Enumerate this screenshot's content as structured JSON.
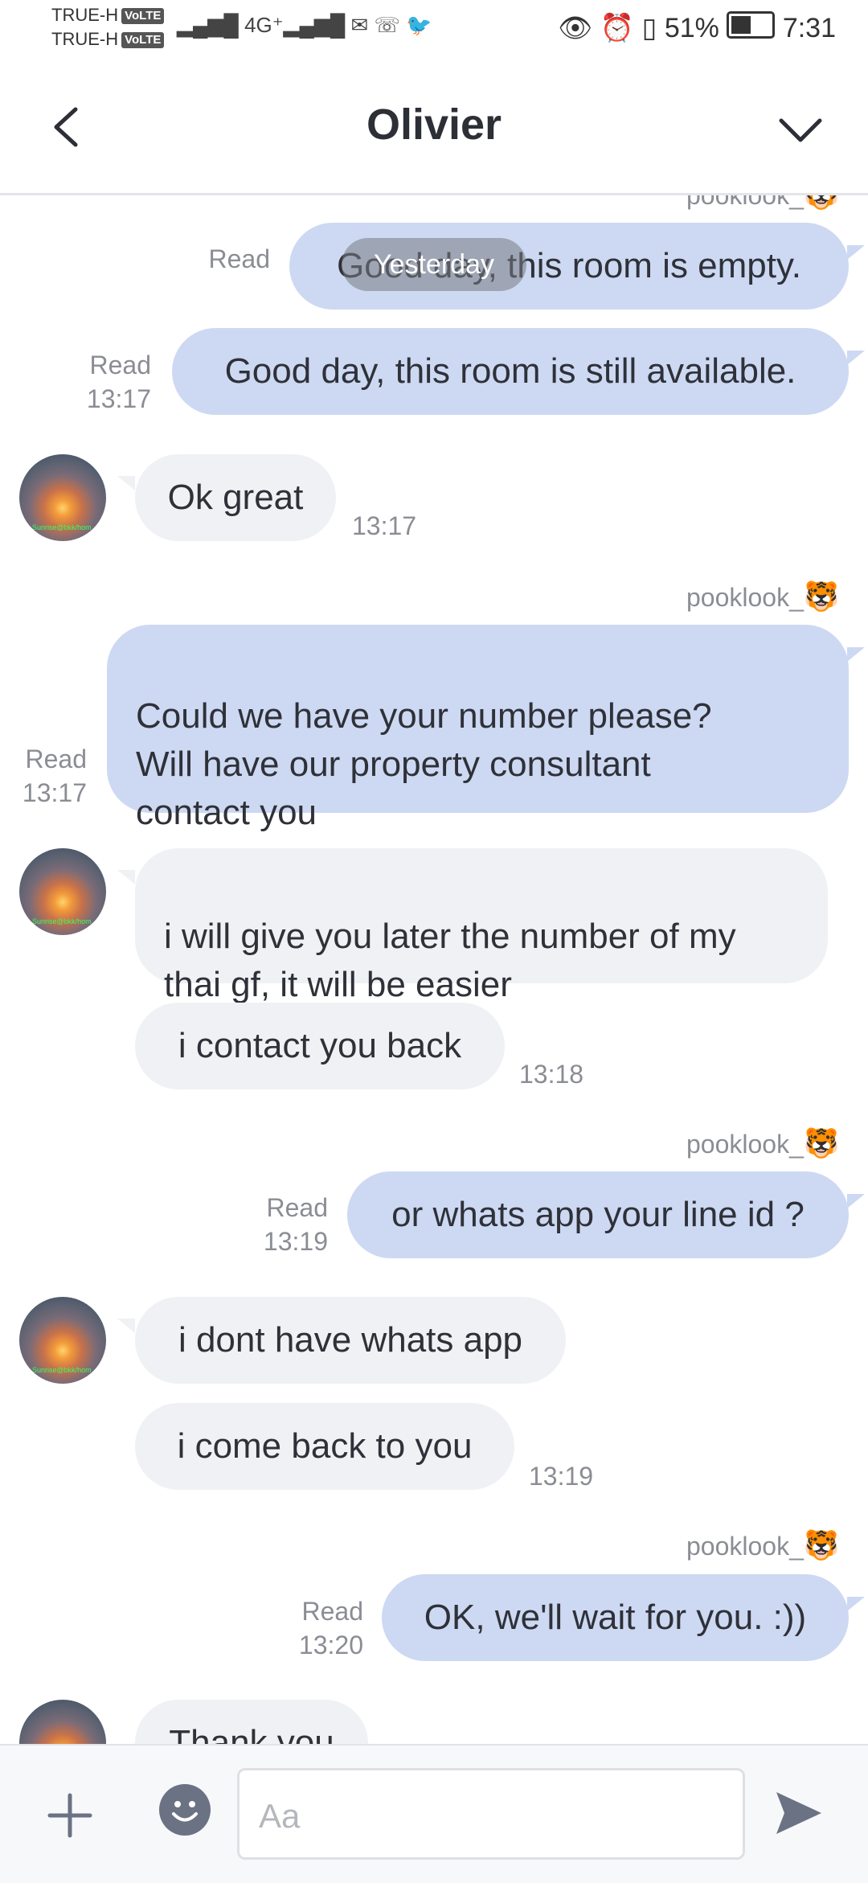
{
  "status_bar": {
    "carrier_1": "TRUE-H",
    "carrier_2": "TRUE-H",
    "volte": "VoLTE",
    "net": "4G⁺",
    "battery": "51%",
    "time": "7:31"
  },
  "header": {
    "title": "Olivier"
  },
  "date_divider": "Yesterday",
  "messages": [
    {
      "text": "pooklook_",
      "kind": "sender"
    },
    {
      "text": "Good day, this room is empty.",
      "read": "Read",
      "time": ""
    },
    {
      "text": "Good day, this room is still available.",
      "read": "Read",
      "time": "13:17"
    },
    {
      "text": "Ok great",
      "time": "13:17"
    },
    {
      "text": "pooklook_",
      "kind": "sender"
    },
    {
      "text": "Could we have your number please?\nWill have our property consultant\ncontact you",
      "read": "Read",
      "time": "13:17"
    },
    {
      "text": "i will give you later the number of my\nthai gf, it will be easier",
      "time": ""
    },
    {
      "text": "i contact you back",
      "time": "13:18"
    },
    {
      "text": "pooklook_",
      "kind": "sender"
    },
    {
      "text": "or whats app your line id ?",
      "read": "Read",
      "time": "13:19"
    },
    {
      "text": "i dont have whats app",
      "time": ""
    },
    {
      "text": "i come back to you",
      "time": "13:19"
    },
    {
      "text": "pooklook_",
      "kind": "sender"
    },
    {
      "text": "OK, we'll wait for you. :))",
      "read": "Read",
      "time": "13:20"
    },
    {
      "text": "Thank you",
      "time": ""
    }
  ],
  "avatar_caption": "Sunrise@bkk/hom",
  "composer": {
    "placeholder": "Aa"
  },
  "colors": {
    "outgoing_bubble": "#cdd9f2",
    "incoming_bubble": "#f0f1f4",
    "accent_icons": "#6b7284"
  },
  "icons": [
    "back-arrow-icon",
    "chevron-down-icon",
    "plus-icon",
    "emoji-icon",
    "send-icon",
    "tiger-emoji-icon"
  ]
}
